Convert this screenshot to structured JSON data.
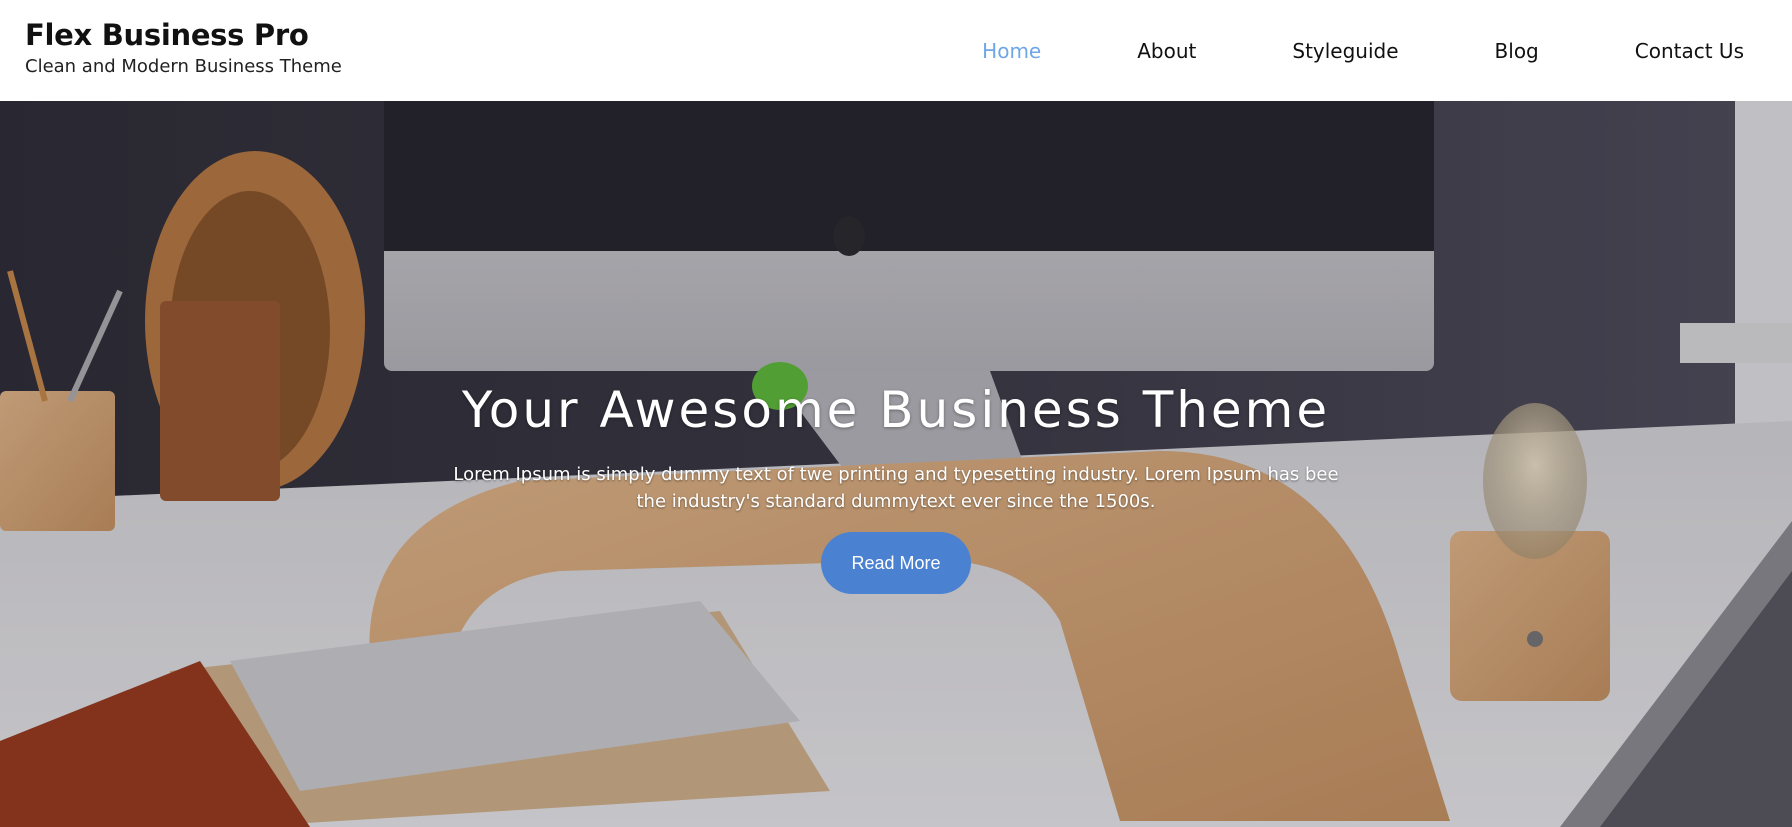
{
  "site": {
    "title": "Flex Business Pro",
    "tagline": "Clean and Modern Business Theme"
  },
  "nav": {
    "items": [
      {
        "label": "Home",
        "active": true
      },
      {
        "label": "About",
        "active": false
      },
      {
        "label": "Styleguide",
        "active": false
      },
      {
        "label": "Blog",
        "active": false
      },
      {
        "label": "Contact Us",
        "active": false
      }
    ]
  },
  "hero": {
    "title": "Your Awesome Business Theme",
    "text": "Lorem Ipsum is simply dummy text of twe printing and typesetting industry. Lorem Ipsum has bee the industry's standard dummytext ever since the 1500s.",
    "button_label": "Read More"
  },
  "colors": {
    "nav_active": "#6fa6e6",
    "button_bg": "#4a82d1",
    "header_bg": "#ffffff",
    "wall": "#3b3a44"
  }
}
